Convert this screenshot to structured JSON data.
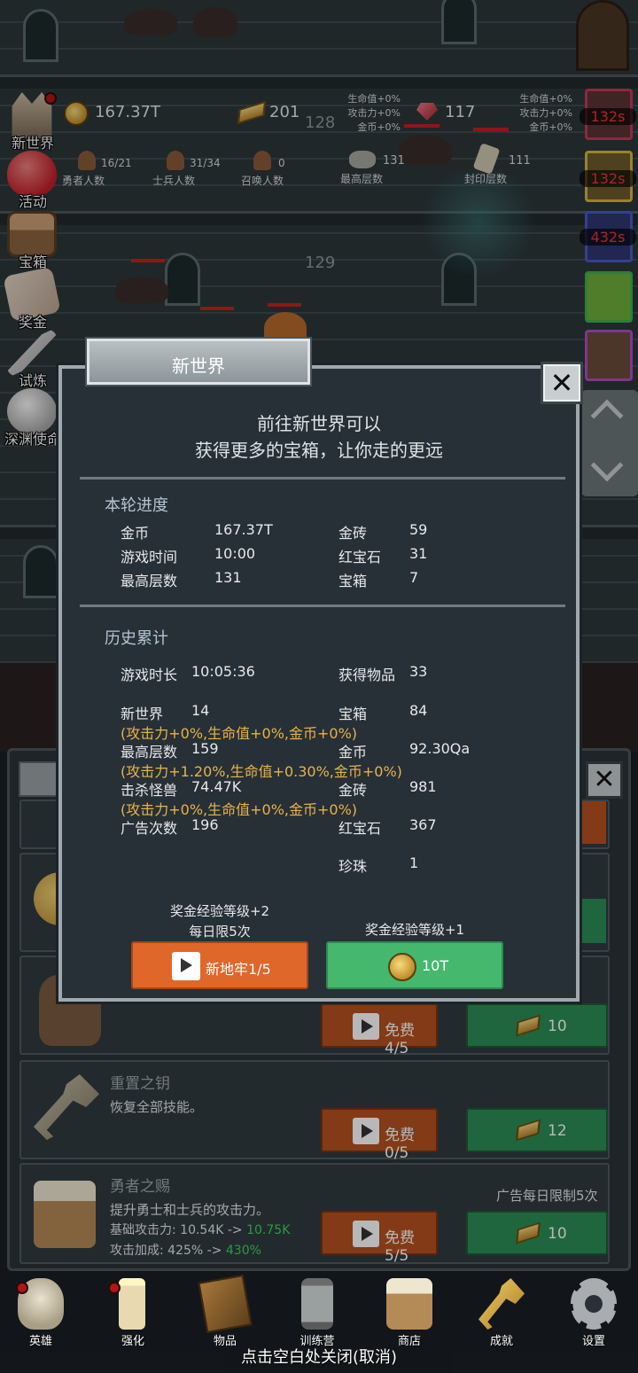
{
  "top_stats": {
    "gold": "167.37T",
    "gold_bars": "201",
    "floor_top": "128",
    "floor_mid": "129",
    "rubies": "117",
    "bonus_left": [
      "生命值+0%",
      "攻击力+0%",
      "金币+0%"
    ],
    "bonus_right": [
      "生命值+0%",
      "攻击力+0%",
      "金币+0%"
    ],
    "heroes_count": "16/21",
    "heroes_label": "勇者人数",
    "soldiers_count": "31/34",
    "soldiers_label": "士兵人数",
    "summon_count": "0",
    "summon_label": "召唤人数",
    "max_floor": "131",
    "max_floor_label": "最高层数",
    "sealed_floor": "111",
    "sealed_floor_label": "封印层数"
  },
  "side_menu": [
    {
      "label": "新世界"
    },
    {
      "label": "活动"
    },
    {
      "label": "宝箱"
    },
    {
      "label": "奖金"
    },
    {
      "label": "试炼"
    },
    {
      "label": "深渊使命"
    }
  ],
  "right_timers": [
    "132s",
    "132s",
    "432s"
  ],
  "shop": {
    "cards": [
      {
        "btn_free": "免费4/5",
        "btn_price": "10"
      },
      {
        "title": "重置之钥",
        "desc": "恢复全部技能。",
        "btn_free": "免费0/5",
        "btn_price": "12"
      },
      {
        "title": "勇者之赐",
        "desc": "提升勇士和士兵的攻击力。",
        "note": "广告每日限制5次",
        "line1_label": "基础攻击力: 10.54K -> ",
        "line1_new": "10.75K",
        "line2_label": "攻击加成: 425% -> ",
        "line2_new": "430%",
        "btn_free": "免费5/5",
        "btn_price": "10"
      }
    ]
  },
  "dialog": {
    "title": "新世界",
    "subtitle_line1": "前往新世界可以",
    "subtitle_line2": "获得更多的宝箱，让你走的更远",
    "round_header": "本轮进度",
    "round": [
      {
        "label": "金币",
        "value": "167.37T",
        "label2": "金砖",
        "value2": "59"
      },
      {
        "label": "游戏时间",
        "value": "10:00",
        "label2": "红宝石",
        "value2": "31"
      },
      {
        "label": "最高层数",
        "value": "131",
        "label2": "宝箱",
        "value2": "7"
      }
    ],
    "history_header": "历史累计",
    "history": {
      "play_time_label": "游戏时长",
      "play_time": "10:05:36",
      "items_label": "获得物品",
      "items": "33",
      "new_world_label": "新世界",
      "new_world": "14",
      "chest_label": "宝箱",
      "chest": "84",
      "new_world_bonus": "(攻击力+0%,生命值+0%,金币+0%)",
      "max_floor_label": "最高层数",
      "max_floor": "159",
      "gold_label": "金币",
      "gold": "92.30Qa",
      "max_floor_bonus": "(攻击力+1.20%,生命值+0.30%,金币+0%)",
      "kills_label": "击杀怪兽",
      "kills": "74.47K",
      "bars_label": "金砖",
      "bars": "981",
      "kills_bonus": "(攻击力+0%,生命值+0%,金币+0%)",
      "ads_label": "广告次数",
      "ads": "196",
      "ruby_label": "红宝石",
      "ruby": "367",
      "pearl_label": "珍珠",
      "pearl": "1"
    },
    "left_note_1": "奖金经验等级+2",
    "left_note_2": "每日限5次",
    "right_note": "奖金经验等级+1",
    "btn_dungeon": "新地牢1/5",
    "btn_gold": "10T"
  },
  "bottom_nav": [
    {
      "label": "英雄"
    },
    {
      "label": "强化"
    },
    {
      "label": "物品"
    },
    {
      "label": "训练营"
    },
    {
      "label": "商店"
    },
    {
      "label": "成就"
    },
    {
      "label": "设置"
    }
  ],
  "close_hint": "点击空白处关闭(取消)",
  "colors": {
    "orange_button": "#b4531f",
    "green_button": "#2c8e56",
    "bonus_text": "#e7b24b",
    "upgrade_value": "#3fd35d"
  }
}
